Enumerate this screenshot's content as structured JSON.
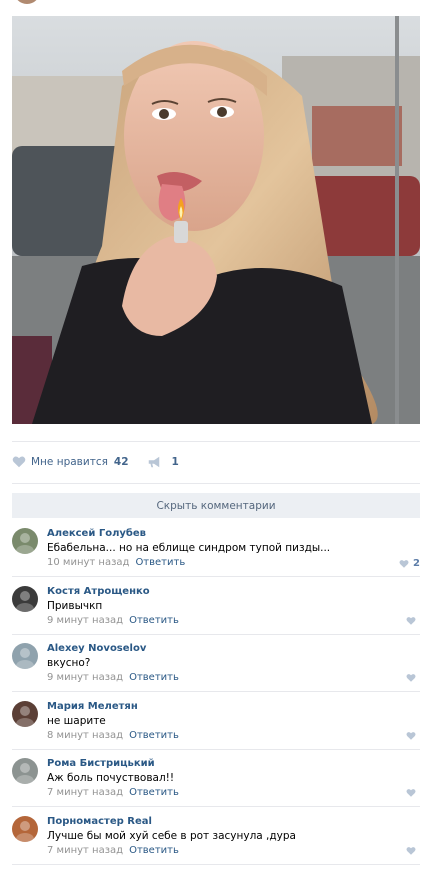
{
  "post": {
    "photo_description": "selfie",
    "likes_label": "Мне нравится",
    "likes_count": "42",
    "shares_count": "1",
    "hide_comments_label": "Скрыть комментарии",
    "colors": {
      "link": "#2a5885",
      "action": "#42648b",
      "muted": "#939393",
      "bar": "#eceff3"
    }
  },
  "comments": [
    {
      "author": "Алексей Голубев",
      "text": "Ебабельна... но на еблище синдром тупой пизды...",
      "time": "10 минут назад",
      "reply": "Ответить",
      "likes": "2",
      "avatar_color": "#7a8a6c"
    },
    {
      "author": "Костя Атрощенко",
      "text": "Привычкп",
      "time": "9 минут назад",
      "reply": "Ответить",
      "likes": "",
      "avatar_color": "#3b3b3b"
    },
    {
      "author": "Alexey Novoselov",
      "text": "вкусно?",
      "time": "9 минут назад",
      "reply": "Ответить",
      "likes": "",
      "avatar_color": "#8fa2ad"
    },
    {
      "author": "Мария Мелетян",
      "text": "не шарите",
      "time": "8 минут назад",
      "reply": "Ответить",
      "likes": "",
      "avatar_color": "#5b3f36"
    },
    {
      "author": "Рома Бистрицький",
      "text": "Аж боль почуствовал!!",
      "time": "7 минут назад",
      "reply": "Ответить",
      "likes": "",
      "avatar_color": "#8c9391"
    },
    {
      "author": "Порномастер Real",
      "text": "Лучше бы мой хуй себе в рот засунула ,дура",
      "time": "7 минут назад",
      "reply": "Ответить",
      "likes": "",
      "avatar_color": "#b4663a"
    }
  ]
}
